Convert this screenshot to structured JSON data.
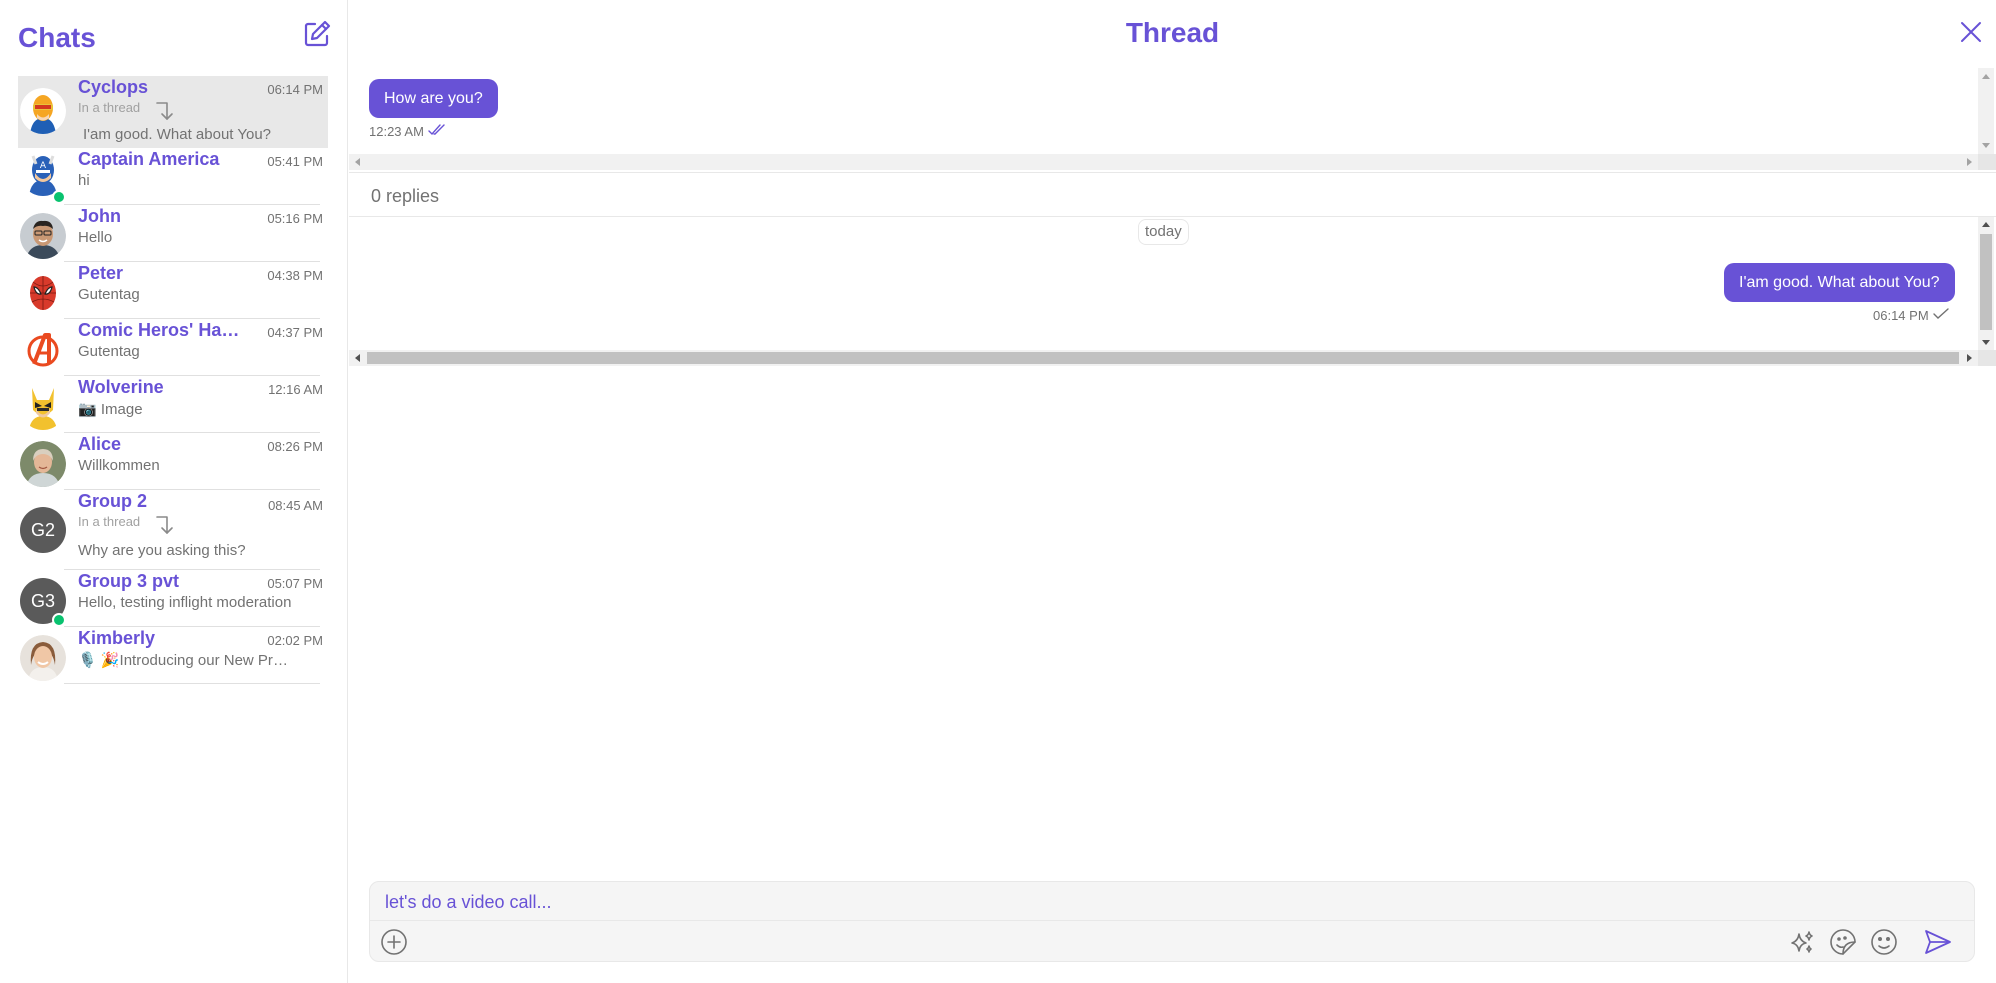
{
  "sidebar": {
    "title": "Chats",
    "chats": [
      {
        "name": "Cyclops",
        "time": "06:14 PM",
        "thread_hint": "In a thread",
        "preview": "I'am good. What about You?",
        "active": true
      },
      {
        "name": "Captain America",
        "time": "05:41 PM",
        "preview": "hi",
        "online": true
      },
      {
        "name": "John",
        "time": "05:16 PM",
        "preview": " Hello"
      },
      {
        "name": "Peter",
        "time": "04:38 PM",
        "preview": "Gutentag"
      },
      {
        "name": "Comic Heros' Hangout",
        "time": "04:37 PM",
        "preview": " Gutentag"
      },
      {
        "name": "Wolverine",
        "time": "12:16 AM",
        "preview": "📷 Image"
      },
      {
        "name": "Alice",
        "time": "08:26 PM",
        "preview": " Willkommen"
      },
      {
        "name": "Group 2",
        "initials": "G2",
        "time": "08:45 AM",
        "thread_hint": "In a thread",
        "preview": "Why are you asking this?"
      },
      {
        "name": "Group 3 pvt",
        "initials": "G3",
        "time": "05:07 PM",
        "preview": " Hello, testing inflight moderation",
        "online": true
      },
      {
        "name": "Kimberly",
        "time": "02:02 PM",
        "preview": "🎙️ 🎉Introducing our New Product"
      }
    ]
  },
  "thread": {
    "title": "Thread",
    "parent_message": {
      "text": "How are you?",
      "time": "12:23 AM",
      "status": "read"
    },
    "replies_label": "0 replies",
    "date_separator": "today",
    "reply_message": {
      "text": "I'am good. What about You?",
      "time": "06:14 PM",
      "status": "sent"
    }
  },
  "composer": {
    "value": "let's do a video call...",
    "placeholder": ""
  },
  "colors": {
    "accent": "#6852d6",
    "online": "#09c26f",
    "muted": "#727272"
  }
}
